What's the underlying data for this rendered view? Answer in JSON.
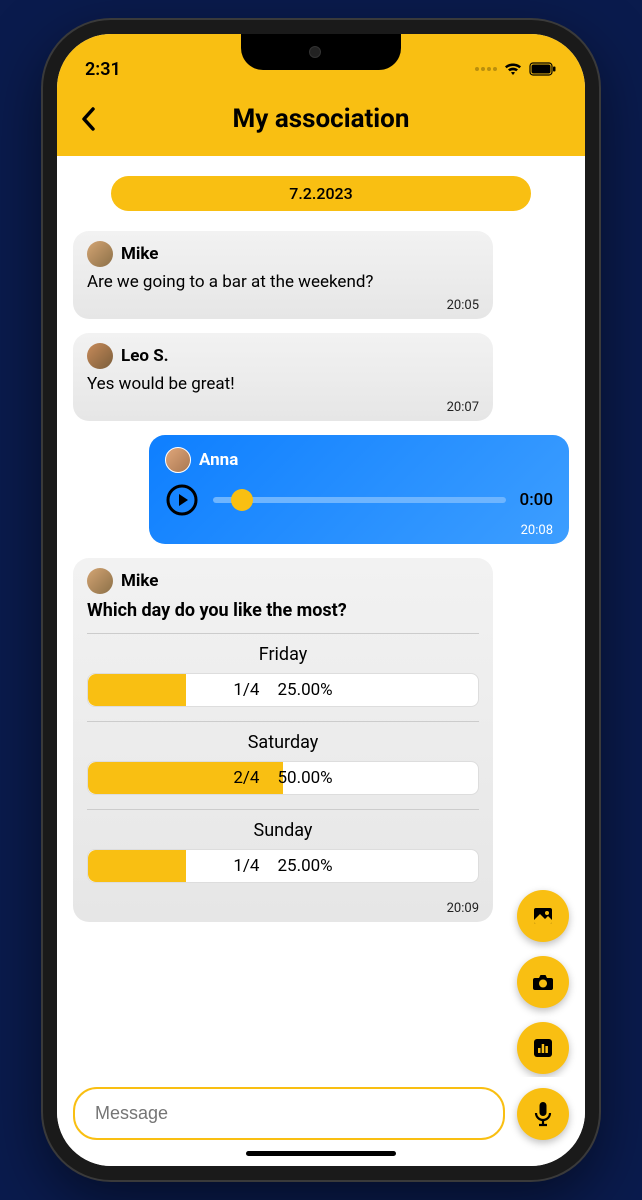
{
  "status": {
    "time": "2:31"
  },
  "header": {
    "title": "My association"
  },
  "date_badge": "7.2.2023",
  "messages": {
    "m1": {
      "sender": "Mike",
      "text": "Are we going to a bar at the weekend?",
      "time": "20:05"
    },
    "m2": {
      "sender": "Leo S.",
      "text": "Yes would be great!",
      "time": "20:07"
    },
    "m3": {
      "sender": "Anna",
      "audio_time": "0:00",
      "time": "20:08"
    },
    "m4": {
      "sender": "Mike",
      "question": "Which day do you like the most?",
      "time": "20:09",
      "options": {
        "o1": {
          "label": "Friday",
          "ratio": "1/4",
          "percent": "25.00%",
          "fill": 25
        },
        "o2": {
          "label": "Saturday",
          "ratio": "2/4",
          "percent": "50.00%",
          "fill": 50
        },
        "o3": {
          "label": "Sunday",
          "ratio": "1/4",
          "percent": "25.00%",
          "fill": 25
        }
      }
    }
  },
  "input": {
    "placeholder": "Message"
  }
}
